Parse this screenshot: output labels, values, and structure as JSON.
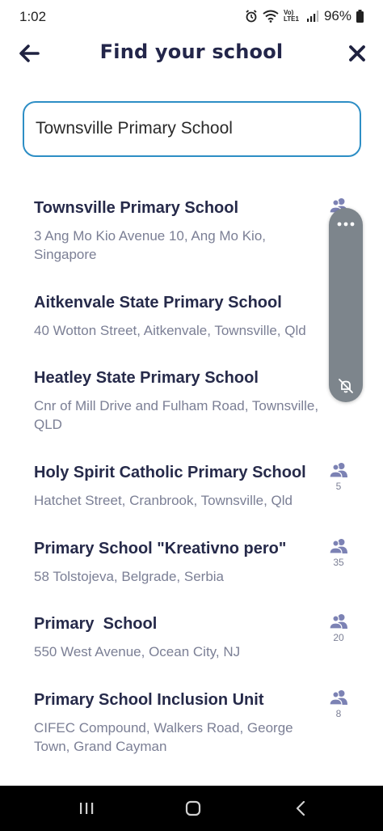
{
  "status_bar": {
    "time": "1:02",
    "network_label": "Vo) LTE1",
    "battery": "96%"
  },
  "header": {
    "title": "Find your school",
    "back_icon": "arrow-left-icon",
    "close_icon": "close-icon"
  },
  "search": {
    "value": "Townsville Primary School"
  },
  "results": [
    {
      "name": "Townsville Primary School",
      "address": "3 Ang Mo Kio Avenue 10, Ang Mo Kio, Singapore",
      "count": ""
    },
    {
      "name": "Aitkenvale State Primary School",
      "address": "40 Wotton Street, Aitkenvale, Townsville, Qld",
      "count": ""
    },
    {
      "name": "Heatley State Primary School",
      "address": "Cnr of Mill Drive and Fulham Road, Townsville, QLD",
      "count": ""
    },
    {
      "name": "Holy Spirit Catholic Primary School",
      "address": "Hatchet Street, Cranbrook, Townsville, Qld",
      "count": "5"
    },
    {
      "name": "Primary School \"Kreativno pero\"",
      "address": "58 Tolstojeva, Belgrade, Serbia",
      "count": "35"
    },
    {
      "name": "Primary  School",
      "address": "550 West Avenue, Ocean City, NJ",
      "count": "20"
    },
    {
      "name": "Primary School Inclusion Unit",
      "address": "CIFEC Compound, Walkers Road, George Town, Grand Cayman",
      "count": "8"
    }
  ],
  "colors": {
    "accent": "#2d8ec5",
    "title": "#23264a",
    "secondary_text": "#7b7f95",
    "people_icon": "#7c82b4",
    "edge_panel": "#7d858c"
  },
  "icons": {
    "people": "people-icon",
    "more": "more-dots-icon",
    "notifications_off": "bell-off-icon"
  }
}
